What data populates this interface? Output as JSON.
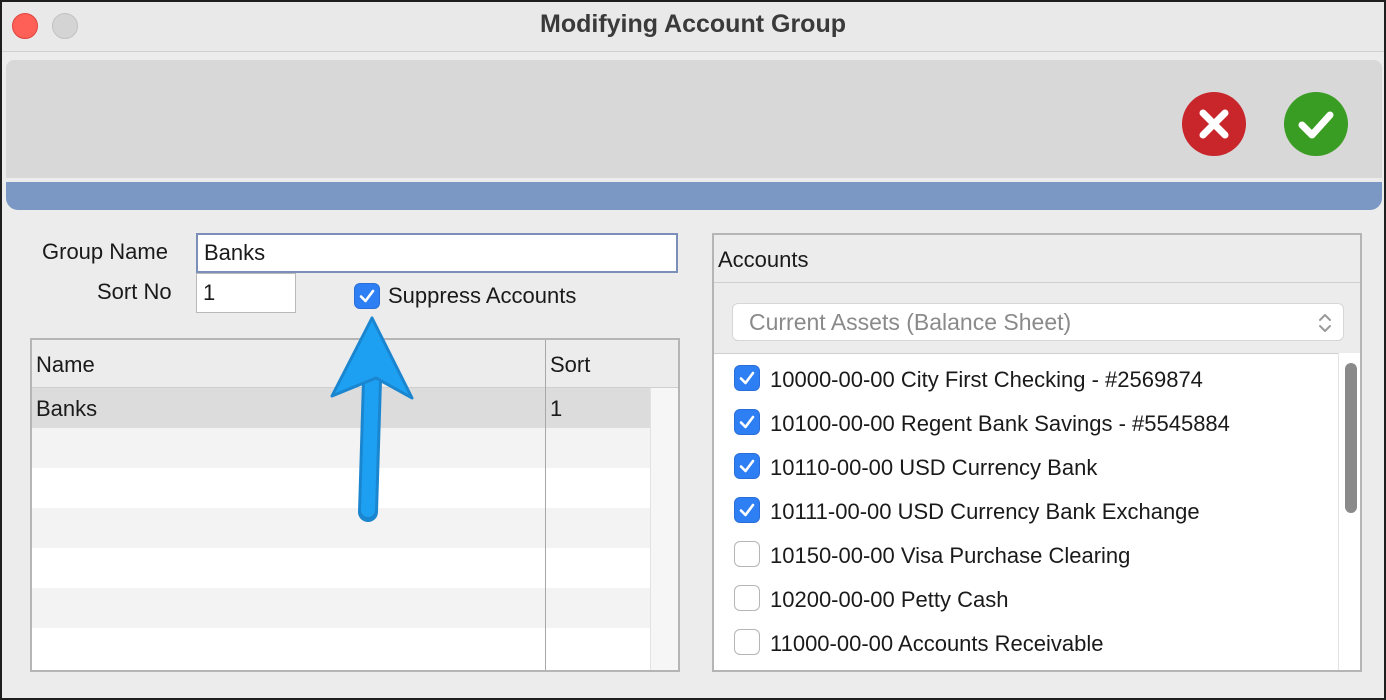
{
  "window": {
    "title": "Modifying Account Group"
  },
  "toolbar": {
    "cancel_icon": "close-icon",
    "ok_icon": "checkmark-icon"
  },
  "form": {
    "group_name_label": "Group Name",
    "group_name_value": "Banks",
    "sort_no_label": "Sort No",
    "sort_no_value": "1",
    "suppress_accounts_label": "Suppress Accounts",
    "suppress_accounts_checked": true
  },
  "groups_table": {
    "columns": [
      "Name",
      "Sort"
    ],
    "rows": [
      {
        "name": "Banks",
        "sort": "1"
      }
    ]
  },
  "accounts_panel": {
    "title": "Accounts",
    "category_select": "Current Assets (Balance Sheet)",
    "items": [
      {
        "label": "10000-00-00 City First Checking - #2569874",
        "checked": true
      },
      {
        "label": "10100-00-00 Regent Bank Savings - #5545884",
        "checked": true
      },
      {
        "label": "10110-00-00 USD Currency Bank",
        "checked": true
      },
      {
        "label": "10111-00-00 USD Currency Bank Exchange",
        "checked": true
      },
      {
        "label": "10150-00-00 Visa Purchase Clearing",
        "checked": false
      },
      {
        "label": "10200-00-00 Petty Cash",
        "checked": false
      },
      {
        "label": "11000-00-00 Accounts Receivable",
        "checked": false
      }
    ]
  },
  "colors": {
    "accent_blue_bar": "#7b97c3",
    "cancel_red": "#c9262b",
    "ok_green": "#3a9d23",
    "checkbox_blue": "#2f7ff4",
    "annotation_arrow": "#1ea0f2"
  },
  "annotation": {
    "icon": "annotation-arrow-icon"
  }
}
